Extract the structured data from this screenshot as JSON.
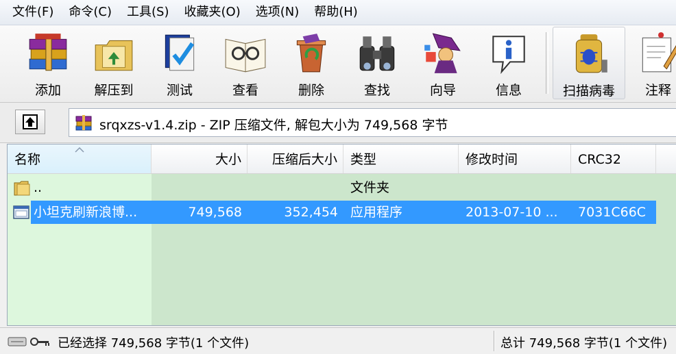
{
  "menu": [
    "文件(F)",
    "命令(C)",
    "工具(S)",
    "收藏夹(O)",
    "选项(N)",
    "帮助(H)"
  ],
  "toolbar": [
    {
      "label": "添加",
      "icon": "books-add-icon"
    },
    {
      "label": "解压到",
      "icon": "extract-folder-icon"
    },
    {
      "label": "测试",
      "icon": "test-book-icon"
    },
    {
      "label": "查看",
      "icon": "view-book-glasses-icon"
    },
    {
      "label": "删除",
      "icon": "delete-recycle-icon"
    },
    {
      "label": "查找",
      "icon": "find-binoculars-icon"
    },
    {
      "label": "向导",
      "icon": "wizard-icon"
    },
    {
      "label": "信息",
      "icon": "info-icon"
    },
    {
      "label": "扫描病毒",
      "icon": "scan-virus-icon"
    },
    {
      "label": "注释",
      "icon": "comment-icon"
    }
  ],
  "address": {
    "text": "srqxzs-v1.4.zip - ZIP 压缩文件, 解包大小为 749,568 字节"
  },
  "columns": [
    "名称",
    "大小",
    "压缩后大小",
    "类型",
    "修改时间",
    "CRC32"
  ],
  "rows": [
    {
      "name": "..",
      "size": "",
      "packed": "",
      "type": "文件夹",
      "modified": "",
      "crc": "",
      "icon": "folder-icon",
      "selected": false
    },
    {
      "name": "小坦克刷新浪博...",
      "size": "749,568",
      "packed": "352,454",
      "type": "应用程序",
      "modified": "2013-07-10 ...",
      "crc": "7031C66C",
      "icon": "exe-file-icon",
      "selected": true
    }
  ],
  "status": {
    "left": "已经选择 749,568 字节(1 个文件)",
    "right": "总计 749,568 字节(1 个文件)"
  }
}
